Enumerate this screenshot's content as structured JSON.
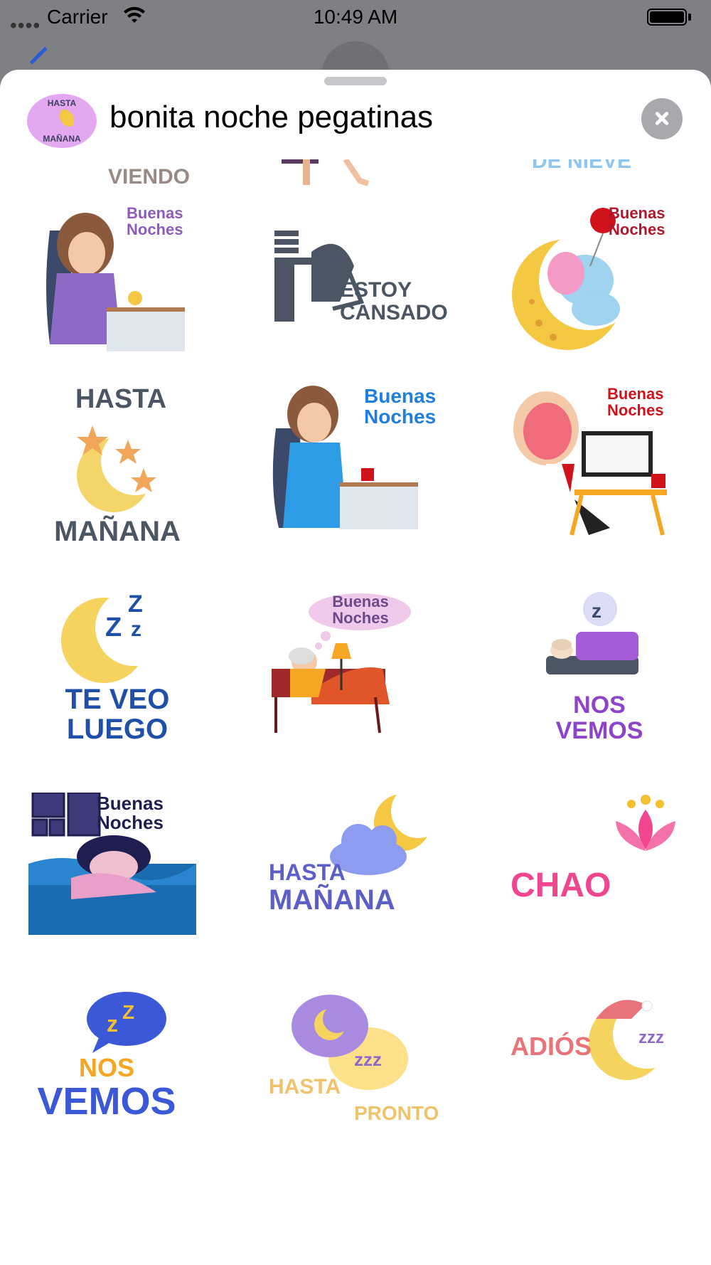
{
  "status_bar": {
    "carrier": "Carrier",
    "time": "10:49 AM"
  },
  "sheet": {
    "title": "bonita noche pegatinas",
    "app_icon": {
      "top_text": "HASTA",
      "bottom_text": "MAÑANA"
    }
  },
  "partial_row": {
    "left": "VIENDO",
    "right": "DE NIEVE"
  },
  "stickers": [
    {
      "name": "buenas-noches-woman-clock",
      "text": "Buenas\nNoches",
      "text_color": "#8e5bbd"
    },
    {
      "name": "estoy-cansado",
      "text": "ESTOY\nCANSADO",
      "text_color": "#4b5563"
    },
    {
      "name": "buenas-noches-elephant-moon",
      "text": "Buenas\nNoches",
      "text_color": "#b0172a"
    },
    {
      "name": "hasta-manana-moon-stars",
      "text_top": "HASTA",
      "text_bottom": "MAÑANA",
      "text_color": "#4b5563"
    },
    {
      "name": "buenas-noches-woman-blue",
      "text": "Buenas\nNoches",
      "text_color": "#1e7fe0"
    },
    {
      "name": "buenas-noches-yawn-desk",
      "text": "Buenas\nNoches",
      "text_color": "#d0121b"
    },
    {
      "name": "te-veo-luego-moon",
      "text": "TE VEO\nLUEGO",
      "text_color": "#1f4fa8"
    },
    {
      "name": "buenas-noches-old-woman-bed",
      "text": "Buenas\nNoches",
      "text_color": "#6b4a8a"
    },
    {
      "name": "nos-vemos-bed",
      "text": "NOS\nVEMOS",
      "text_color": "#8e44c9"
    },
    {
      "name": "buenas-noches-sleeping-woman",
      "text": "Buenas\nNoches",
      "text_color": "#1e1e50"
    },
    {
      "name": "hasta-manana-cloud-moon",
      "text_top": "HASTA",
      "text_bottom": "MAÑANA",
      "text_color": "#5b5fc7"
    },
    {
      "name": "chao-lotus",
      "text": "CHAO",
      "text_color": "#f0458f"
    },
    {
      "name": "nos-vemos-bubble",
      "text_top": "NOS",
      "text_bottom": "VEMOS",
      "text_color": "#3b59d6",
      "text_top_color": "#f5a623"
    },
    {
      "name": "hasta-pronto-bubbles",
      "text_top": "HASTA",
      "text_bottom": "PRONTO",
      "text_color": "#f0c36a"
    },
    {
      "name": "adios-moon-cap",
      "text": "ADIÓS",
      "text_color": "#e8747a"
    }
  ]
}
